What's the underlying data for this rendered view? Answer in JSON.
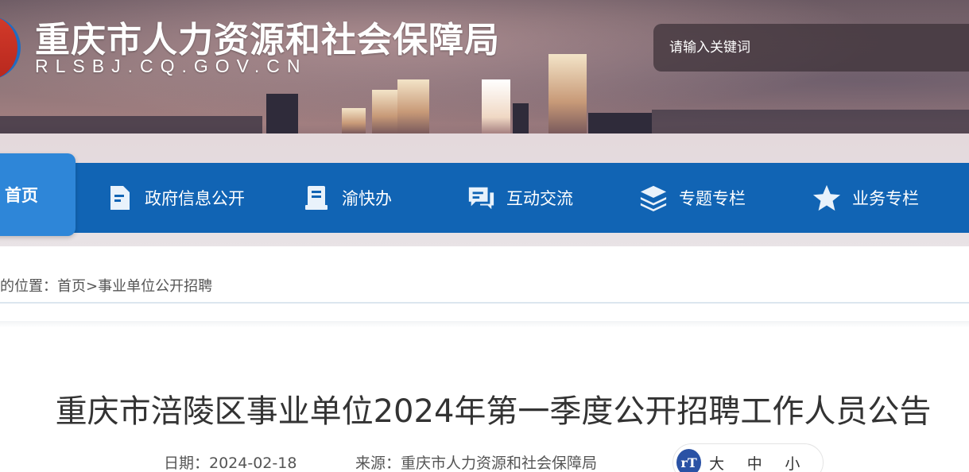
{
  "header": {
    "site_title": "重庆市人力资源和社会保障局",
    "site_domain": "RLSBJ.CQ.GOV.CN",
    "search_placeholder": "请输入关键词"
  },
  "nav": {
    "home_label": "首页",
    "items": [
      {
        "label": "政府信息公开",
        "icon": "document-icon"
      },
      {
        "label": "渝快办",
        "icon": "clipboard-icon"
      },
      {
        "label": "互动交流",
        "icon": "chat-icon"
      },
      {
        "label": "专题专栏",
        "icon": "layers-icon"
      },
      {
        "label": "业务专栏",
        "icon": "star-icon"
      }
    ]
  },
  "breadcrumb": {
    "prefix": "的位置：",
    "home": "首页",
    "separator": ">",
    "current": "事业单位公开招聘"
  },
  "article": {
    "title": "重庆市涪陵区事业单位2024年第一季度公开招聘工作人员公告",
    "date_label": "日期：2024-02-18",
    "source_label": "来源：重庆市人力资源和社会保障局",
    "font_size": {
      "icon_text": "rT",
      "large": "大",
      "medium": "中",
      "small": "小"
    }
  },
  "colors": {
    "nav_bg": "#1164b4",
    "nav_home_bg": "#2e86d8",
    "text": "#333333"
  }
}
